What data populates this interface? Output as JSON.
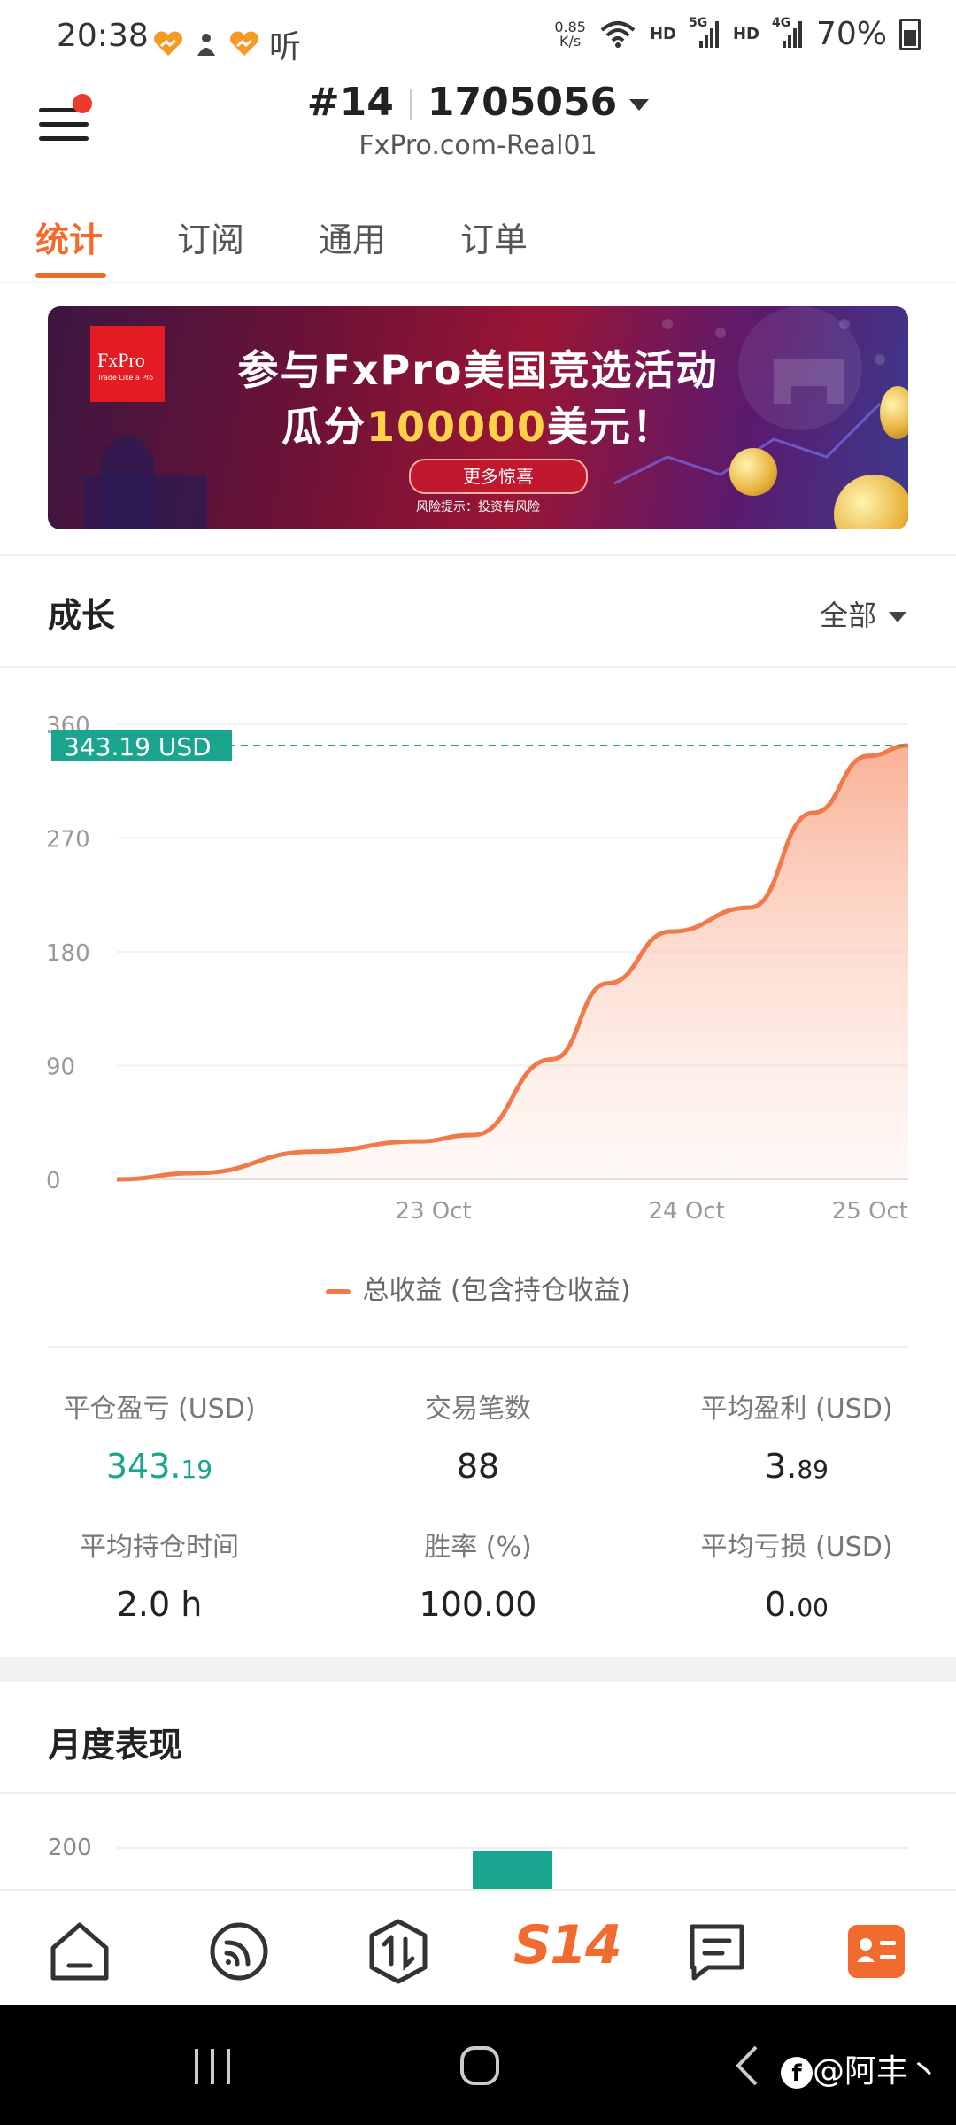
{
  "status_bar": {
    "time": "20:38",
    "notif_text": "听",
    "speed_value": "0.85",
    "speed_unit": "K/s",
    "hd1": "HD",
    "net1": "5G",
    "hd2": "HD",
    "net2": "4G",
    "battery": "70%"
  },
  "header": {
    "account_number": "#14",
    "account_id": "1705056",
    "server": "FxPro.com-Real01"
  },
  "tabs": [
    {
      "label": "统计",
      "active": true
    },
    {
      "label": "订阅",
      "active": false
    },
    {
      "label": "通用",
      "active": false
    },
    {
      "label": "订单",
      "active": false
    }
  ],
  "banner": {
    "logo_text": "FxPro",
    "logo_sub": "Trade Like a Pro",
    "line1": "参与FxPro美国竞选活动",
    "line2_prefix": "瓜分",
    "line2_amount": "100000",
    "line2_suffix": "美元！",
    "button": "更多惊喜",
    "risk": "风险提示：投资有风险"
  },
  "growth": {
    "title": "成长",
    "filter": "全部",
    "current_value_label": "343.19 USD",
    "legend": "总收益 (包含持仓收益)"
  },
  "chart_data": {
    "type": "area",
    "title": "",
    "xlabel": "",
    "ylabel": "",
    "ylim": [
      0,
      360
    ],
    "yticks": [
      0,
      90,
      180,
      270,
      360
    ],
    "xtick_labels": [
      "23 Oct",
      "24 Oct",
      "25 Oct"
    ],
    "series": [
      {
        "name": "总收益 (包含持仓收益)",
        "color": "#f07a4a",
        "points": [
          {
            "x": 0.0,
            "y": 0
          },
          {
            "x": 0.1,
            "y": 5
          },
          {
            "x": 0.25,
            "y": 22
          },
          {
            "x": 0.38,
            "y": 30
          },
          {
            "x": 0.45,
            "y": 35
          },
          {
            "x": 0.55,
            "y": 95
          },
          {
            "x": 0.62,
            "y": 155
          },
          {
            "x": 0.7,
            "y": 196
          },
          {
            "x": 0.8,
            "y": 215
          },
          {
            "x": 0.88,
            "y": 290
          },
          {
            "x": 0.95,
            "y": 335
          },
          {
            "x": 1.0,
            "y": 343.19
          }
        ]
      }
    ],
    "reference_line": {
      "value": 343.19,
      "label": "343.19 USD",
      "color": "#1aa58f"
    },
    "grid": true
  },
  "stats": [
    {
      "label": "平仓盈亏 (USD)",
      "int": "343.",
      "dec": "19",
      "green": true
    },
    {
      "label": "交易笔数",
      "int": "88",
      "dec": "",
      "green": false
    },
    {
      "label": "平均盈利 (USD)",
      "int": "3.",
      "dec": "89",
      "green": false
    },
    {
      "label": "平均持仓时间",
      "int": "2.0 h",
      "dec": "",
      "green": false
    },
    {
      "label": "胜率 (%)",
      "int": "100.00",
      "dec": "",
      "green": false
    },
    {
      "label": "平均亏损 (USD)",
      "int": "0.",
      "dec": "00",
      "green": false
    }
  ],
  "monthly": {
    "title": "月度表现",
    "ytick": "200",
    "bar_color": "#1aa58f"
  },
  "bottom_nav": {
    "center_label": "S14",
    "icons": [
      "home-icon",
      "signal-feed-icon",
      "trade-icon",
      "s14-tab",
      "chat-icon",
      "profile-card-icon"
    ]
  },
  "watermark": "@阿丰丶"
}
